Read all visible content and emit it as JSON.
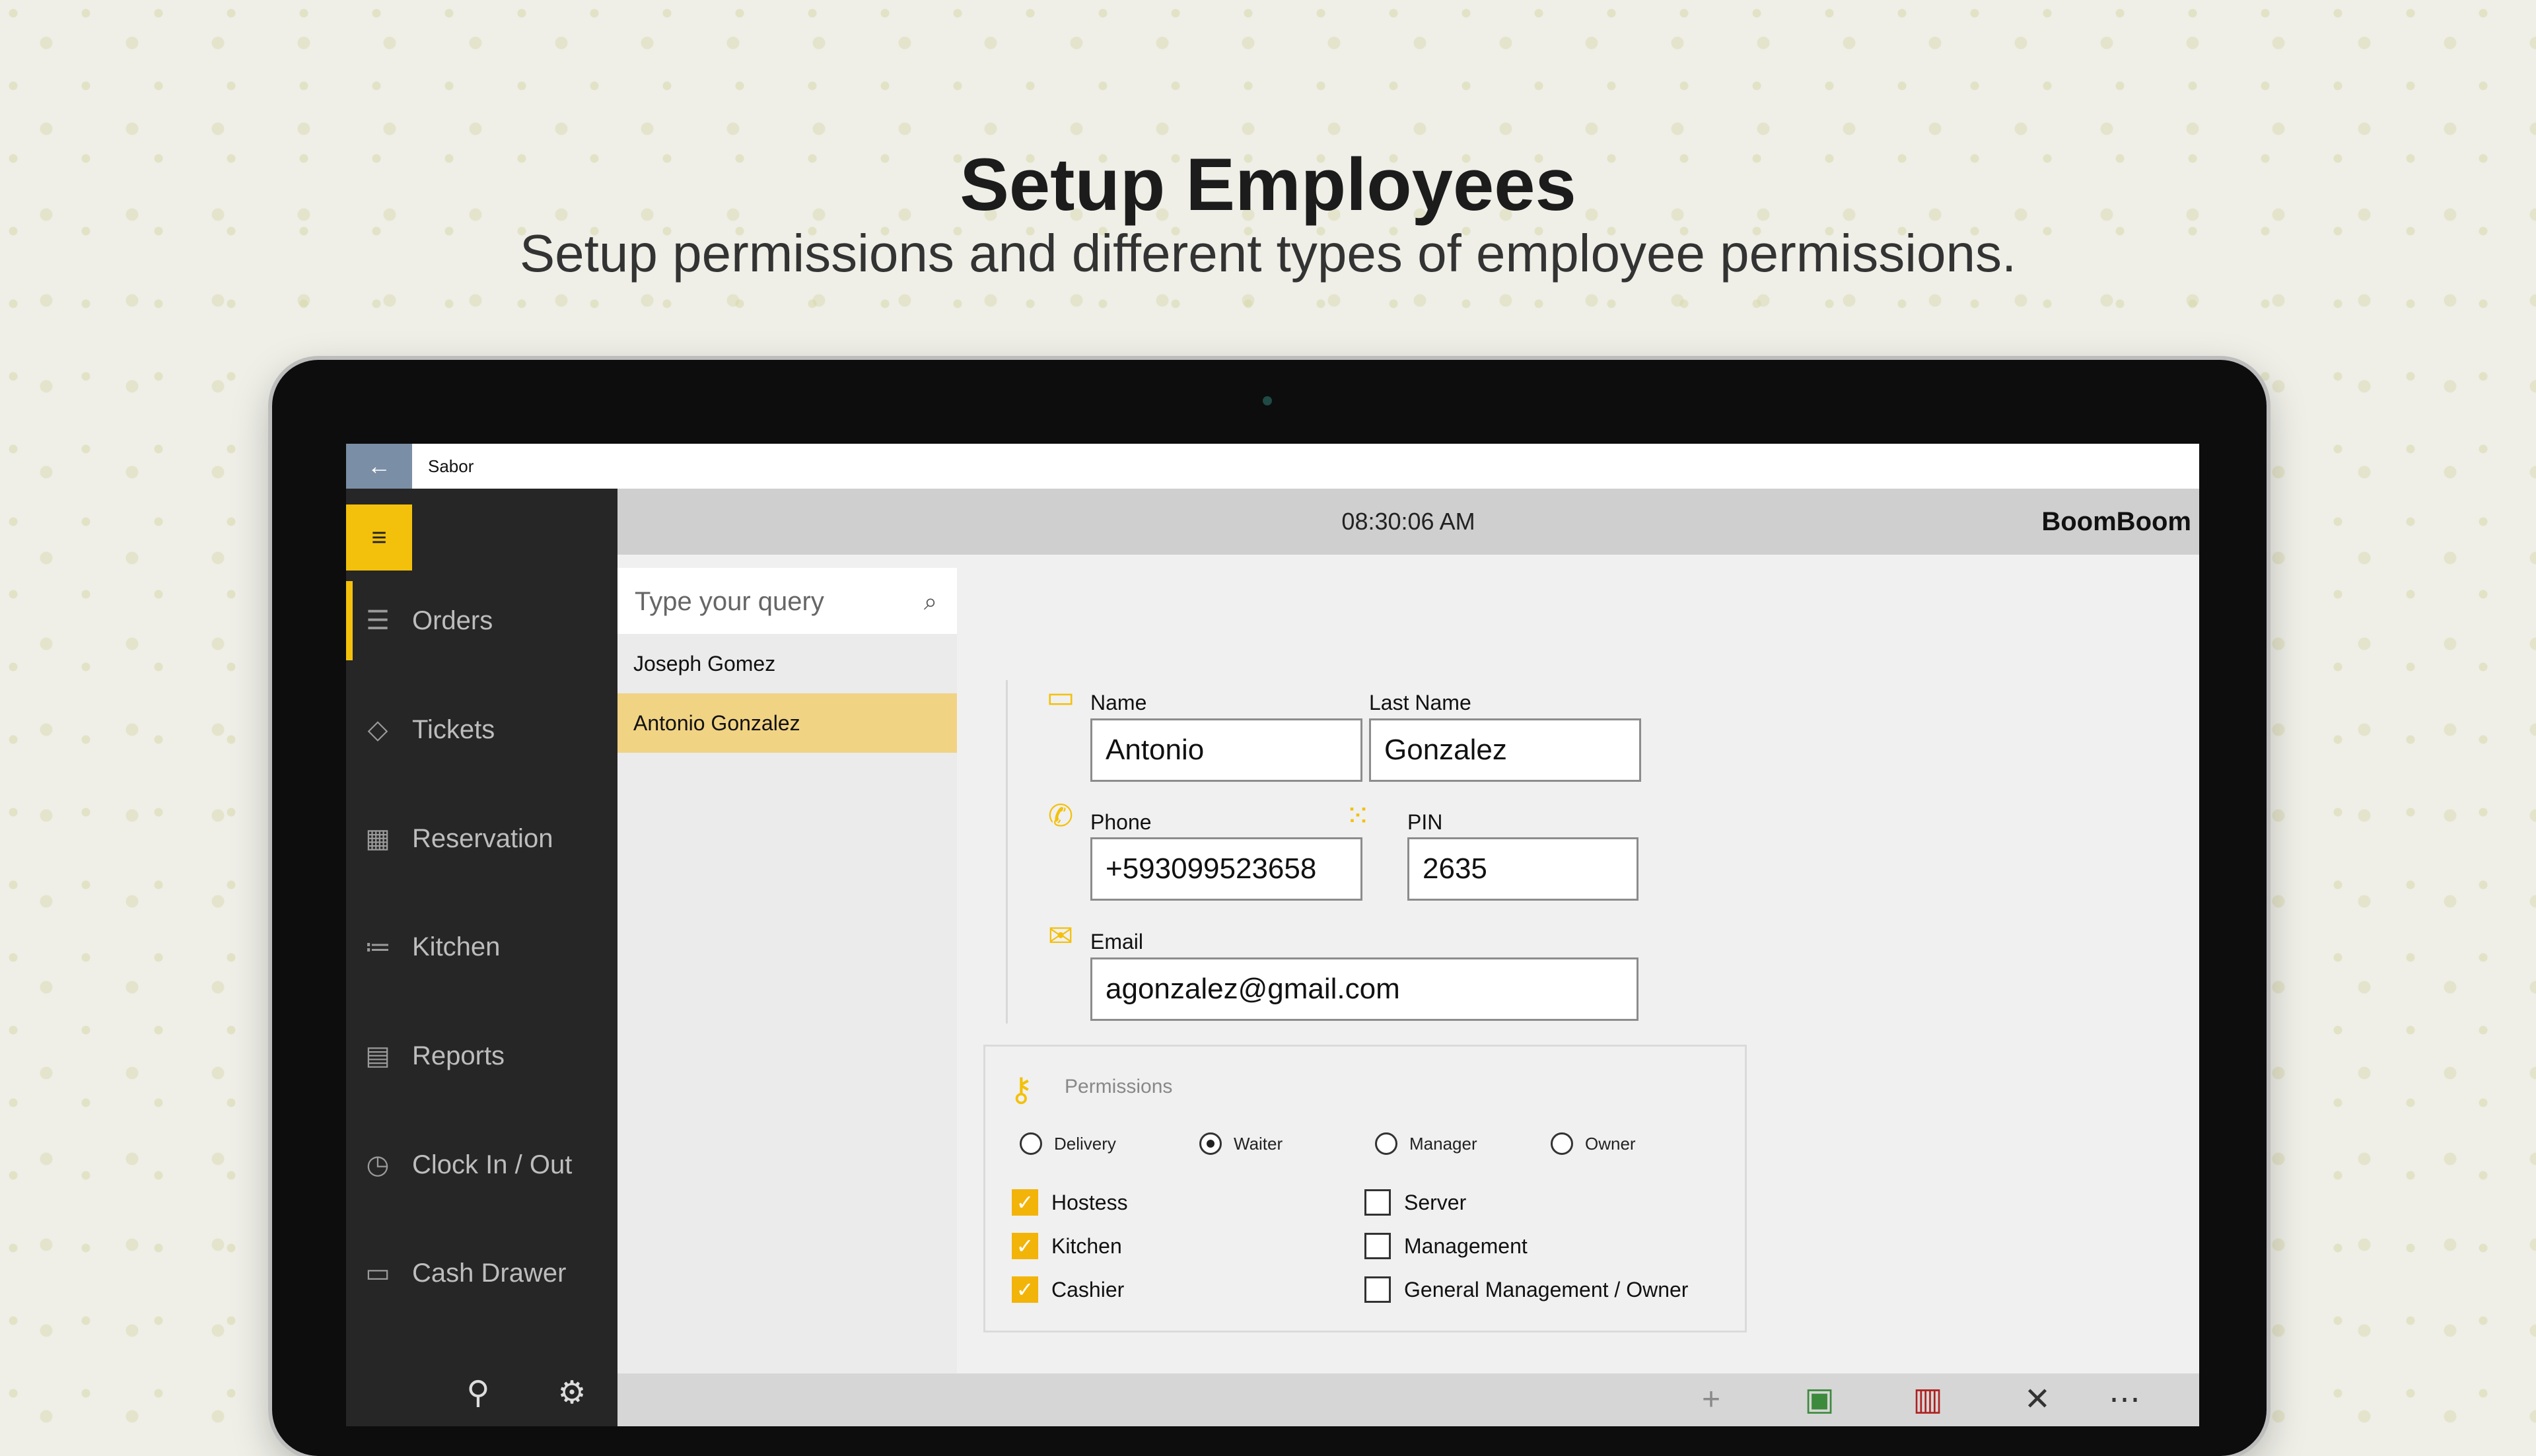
{
  "headline": {
    "title": "Setup Employees",
    "subtitle": "Setup permissions and different types of employee permissions."
  },
  "window": {
    "back_glyph": "←",
    "title": "Sabor"
  },
  "sidebar": {
    "menu_glyph": "≡",
    "items": [
      {
        "label": "Orders",
        "icon": "list-icon",
        "glyph": "☰"
      },
      {
        "label": "Tickets",
        "icon": "tag-icon",
        "glyph": "◇"
      },
      {
        "label": "Reservation",
        "icon": "calendar-icon",
        "glyph": "▦"
      },
      {
        "label": "Kitchen",
        "icon": "checklist-icon",
        "glyph": "≔"
      },
      {
        "label": "Reports",
        "icon": "report-icon",
        "glyph": "▤"
      },
      {
        "label": "Clock In / Out",
        "icon": "clock-icon",
        "glyph": "◷"
      },
      {
        "label": "Cash Drawer",
        "icon": "cash-drawer-icon",
        "glyph": "▭"
      }
    ],
    "active_index": 0,
    "bottom_icons": [
      {
        "icon": "user-switch-icon",
        "glyph": "⚲"
      },
      {
        "icon": "gear-icon",
        "glyph": "⚙"
      }
    ]
  },
  "header": {
    "time": "08:30:06 AM",
    "brand": "BoomBoom"
  },
  "search": {
    "placeholder": "Type your query",
    "icon_glyph": "⌕"
  },
  "employees": [
    {
      "name": "Joseph  Gomez",
      "selected": false
    },
    {
      "name": "Antonio  Gonzalez",
      "selected": true
    }
  ],
  "form": {
    "name_label": "Name",
    "name_value": "Antonio",
    "last_name_label": "Last Name",
    "last_name_value": "Gonzalez",
    "phone_label": "Phone",
    "phone_value": "+593099523658",
    "pin_label": "PIN",
    "pin_value": "2635",
    "email_label": "Email",
    "email_value": "agonzalez@gmail.com",
    "icons": {
      "name": "▭",
      "phone": "✆",
      "pin": "⁙",
      "email": "✉"
    }
  },
  "permissions": {
    "title": "Permissions",
    "key_glyph": "⚷",
    "roles": [
      {
        "label": "Delivery",
        "selected": false
      },
      {
        "label": "Waiter",
        "selected": true
      },
      {
        "label": "Manager",
        "selected": false
      },
      {
        "label": "Owner",
        "selected": false
      }
    ],
    "checks_left": [
      {
        "label": "Hostess",
        "checked": true
      },
      {
        "label": "Kitchen",
        "checked": true
      },
      {
        "label": "Cashier",
        "checked": true
      }
    ],
    "checks_right": [
      {
        "label": "Server",
        "checked": false
      },
      {
        "label": "Management",
        "checked": false
      },
      {
        "label": "General Management / Owner",
        "checked": false
      }
    ],
    "check_glyph": "✓"
  },
  "commands": [
    {
      "icon": "add-icon",
      "glyph": "+",
      "color": "#8a8a8a"
    },
    {
      "icon": "save-icon",
      "glyph": "▣",
      "color": "#3c8a3c"
    },
    {
      "icon": "delete-icon",
      "glyph": "▥",
      "color": "#b02020"
    },
    {
      "icon": "close-icon",
      "glyph": "✕",
      "color": "#333333"
    },
    {
      "icon": "more-icon",
      "glyph": "⋯",
      "color": "#333333"
    }
  ],
  "colors": {
    "accent": "#f3c10b",
    "selected_row": "#f1d384",
    "sidebar": "#262626"
  }
}
